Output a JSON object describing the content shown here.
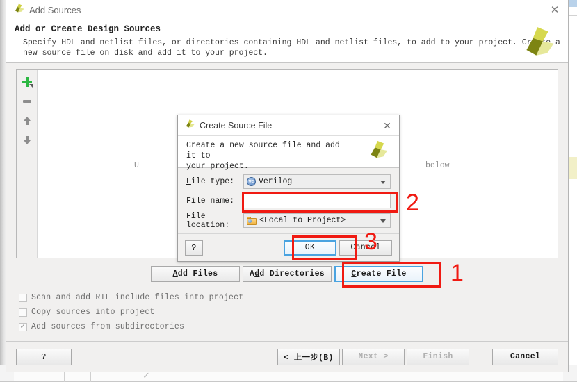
{
  "window": {
    "title": "Add Sources",
    "close_label": "✕",
    "logo_name": "vivado-logo"
  },
  "header": {
    "title": "Add or Create Design Sources",
    "description": "Specify HDL and netlist files, or directories containing HDL and netlist files, to add to your project. Create a\nnew source file on disk and add it to your project."
  },
  "toolstrip": {
    "add_label": "+",
    "remove_label": "−",
    "move_up_label": "↑",
    "move_down_label": "↓"
  },
  "listpane": {
    "hint_left": "U",
    "hint_right": "below"
  },
  "actions": [
    {
      "label": "Add Files",
      "mnemonic_index": 0,
      "focused": false,
      "name": "add-files-button"
    },
    {
      "label": "Add Directories",
      "mnemonic_index": 2,
      "focused": false,
      "name": "add-directories-button"
    },
    {
      "label": "Create File",
      "mnemonic_index": 1,
      "focused": true,
      "name": "create-file-button"
    }
  ],
  "checkboxes": [
    {
      "label": "Scan and add RTL include files into project",
      "checked": false
    },
    {
      "label": "Copy sources into project",
      "checked": false
    },
    {
      "label": "Add sources from subdirectories",
      "checked": true
    }
  ],
  "footer": {
    "help_label": "?",
    "back_label": "< 上一步(B)",
    "next_label": "Next >",
    "finish_label": "Finish",
    "cancel_label": "Cancel"
  },
  "modal": {
    "title": "Create Source File",
    "close_label": "✕",
    "description": "Create a new source file and add it to\nyour project.",
    "fields": {
      "file_type": {
        "label": "File type:",
        "value": "Verilog",
        "icon": "verilog-badge-icon"
      },
      "file_name": {
        "label": "File name:",
        "value": "",
        "placeholder": ""
      },
      "file_location": {
        "label": "File location:",
        "value": "<Local to Project>",
        "icon": "folder-icon"
      }
    },
    "buttons": {
      "help_label": "?",
      "ok_label": "OK",
      "cancel_label": "Cancel"
    }
  },
  "annotations": {
    "marker_1": "1",
    "marker_2": "2",
    "marker_3": "3",
    "color": "#f01a12"
  },
  "background": {
    "ghost_text": "."
  }
}
